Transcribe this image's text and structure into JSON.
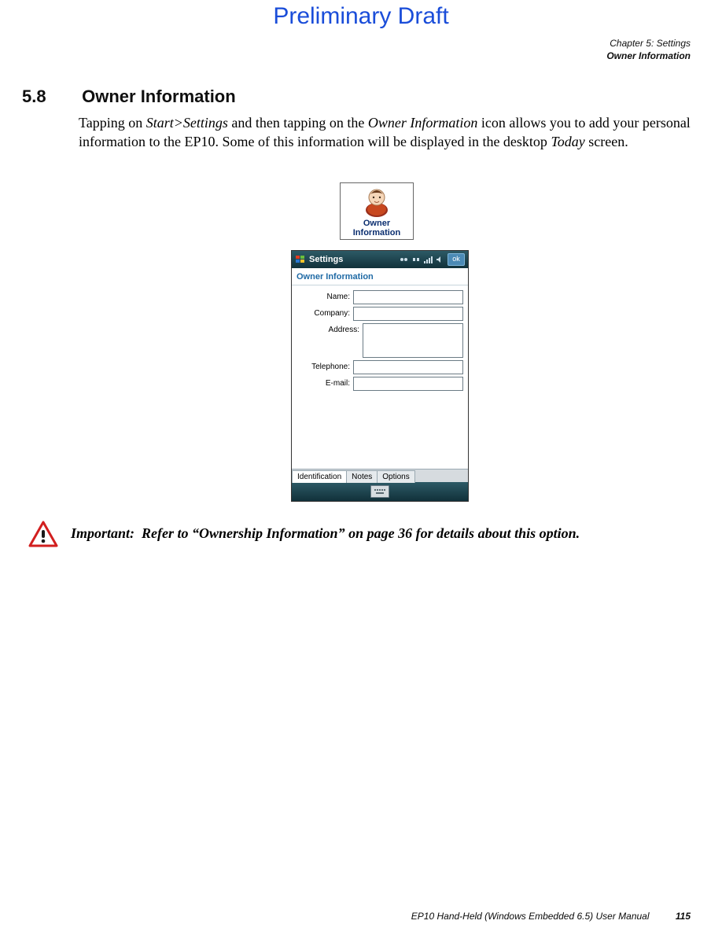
{
  "draft_banner": "Preliminary Draft",
  "header": {
    "chapter": "Chapter 5: Settings",
    "subtitle": "Owner Information"
  },
  "section": {
    "number": "5.8",
    "title": "Owner Information"
  },
  "paragraph": {
    "p1a": "Tapping on ",
    "p1b": "Start>Settings",
    "p1c": " and then tapping on the ",
    "p1d": "Owner Information",
    "p1e": " icon allows you to add your personal information to the EP10. Some of this information will be displayed in the desktop ",
    "p1f": "Today",
    "p1g": " screen."
  },
  "icon_shot": {
    "line1": "Owner",
    "line2": "Information"
  },
  "screenshot": {
    "titlebar": {
      "title": "Settings",
      "ok": "ok"
    },
    "panel_title": "Owner Information",
    "fields": {
      "name_label": "Name:",
      "company_label": "Company:",
      "address_label": "Address:",
      "telephone_label": "Telephone:",
      "email_label": "E-mail:",
      "name_value": "",
      "company_value": "",
      "address_value": "",
      "telephone_value": "",
      "email_value": ""
    },
    "tabs": {
      "identification": "Identification",
      "notes": "Notes",
      "options": "Options"
    }
  },
  "important": {
    "label": "Important:",
    "text": "Refer to “Ownership Information” on page 36 for details about this option."
  },
  "footer": {
    "manual": "EP10 Hand-Held (Windows Embedded 6.5) User Manual",
    "page": "115"
  }
}
